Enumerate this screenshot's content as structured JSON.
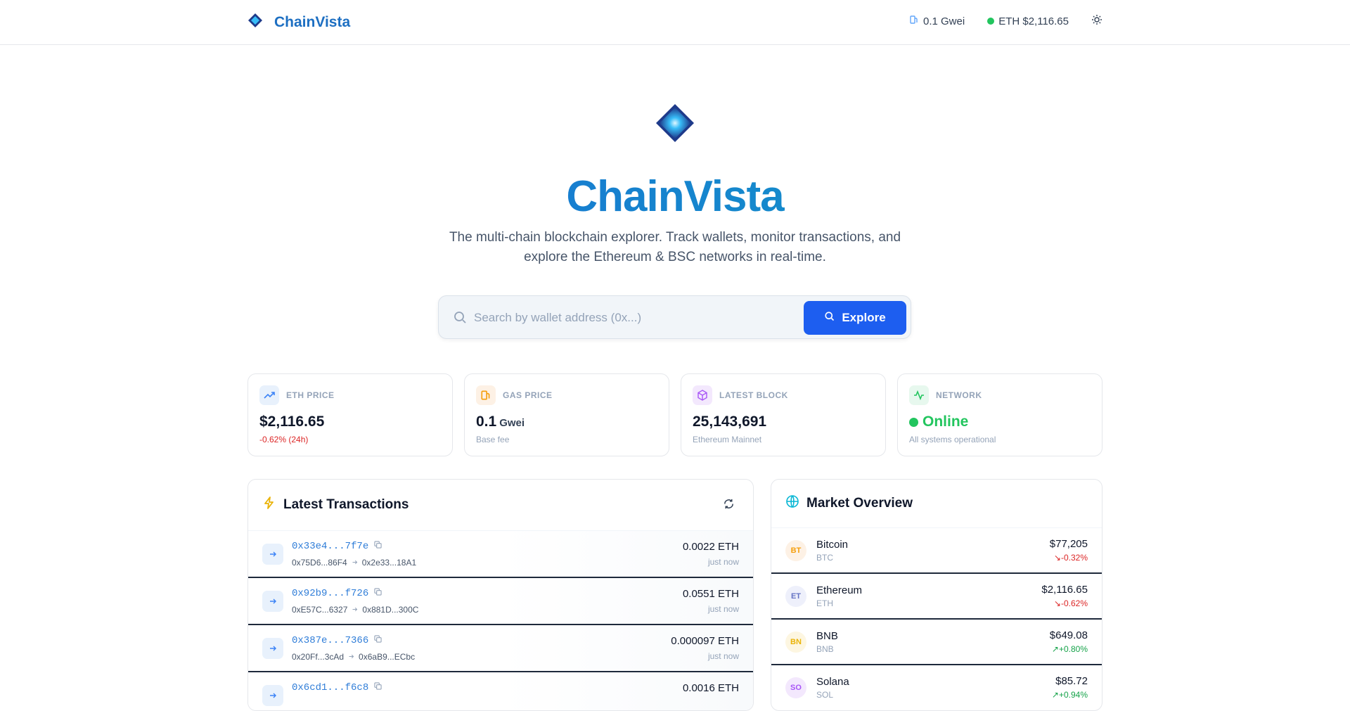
{
  "header": {
    "brand": "ChainVista",
    "gas": "0.1 Gwei",
    "eth_price": "ETH $2,116.65"
  },
  "hero": {
    "title": "ChainVista",
    "subtitle": "The multi-chain blockchain explorer. Track wallets, monitor transactions, and explore the Ethereum & BSC networks in real-time."
  },
  "search": {
    "placeholder": "Search by wallet address (0x...)",
    "button": "Explore"
  },
  "stats": [
    {
      "label": "ETH PRICE",
      "value": "$2,116.65",
      "sub": "-0.62% (24h)"
    },
    {
      "label": "GAS PRICE",
      "value": "0.1",
      "unit": "Gwei",
      "sub": "Base fee"
    },
    {
      "label": "LATEST BLOCK",
      "value": "25,143,691",
      "sub": "Ethereum Mainnet"
    },
    {
      "label": "NETWORK",
      "value": "Online",
      "sub": "All systems operational"
    }
  ],
  "transactions": {
    "title": "Latest Transactions",
    "rows": [
      {
        "hash": "0x33e4...7f7e",
        "from": "0x75D6...86F4",
        "to": "0x2e33...18A1",
        "amount": "0.0022 ETH",
        "time": "just now"
      },
      {
        "hash": "0x92b9...f726",
        "from": "0xE57C...6327",
        "to": "0x881D...300C",
        "amount": "0.0551 ETH",
        "time": "just now"
      },
      {
        "hash": "0x387e...7366",
        "from": "0x20Ff...3cAd",
        "to": "0x6aB9...ECbc",
        "amount": "0.000097 ETH",
        "time": "just now"
      },
      {
        "hash": "0x6cd1...f6c8",
        "from": "",
        "to": "",
        "amount": "0.0016 ETH",
        "time": ""
      }
    ]
  },
  "market": {
    "title": "Market Overview",
    "rows": [
      {
        "badge": "BT",
        "name": "Bitcoin",
        "symbol": "BTC",
        "price": "$77,205",
        "change": "-0.32%"
      },
      {
        "badge": "ET",
        "name": "Ethereum",
        "symbol": "ETH",
        "price": "$2,116.65",
        "change": "-0.62%"
      },
      {
        "badge": "BN",
        "name": "BNB",
        "symbol": "BNB",
        "price": "$649.08",
        "change": "+0.80%"
      },
      {
        "badge": "SO",
        "name": "Solana",
        "symbol": "SOL",
        "price": "$85.72",
        "change": "+0.94%"
      }
    ]
  },
  "colors": {
    "accent": "#1d5ef0",
    "brand": "#1d6fc2",
    "positive": "#16a34a",
    "negative": "#dc2626",
    "online": "#22c55e"
  },
  "icons": {
    "brand": "diamond-logo-icon",
    "gas": "fuel-icon",
    "theme": "sun-icon",
    "search": "search-icon",
    "refresh": "refresh-icon",
    "market": "globe-icon",
    "transactions": "lightning-icon"
  }
}
